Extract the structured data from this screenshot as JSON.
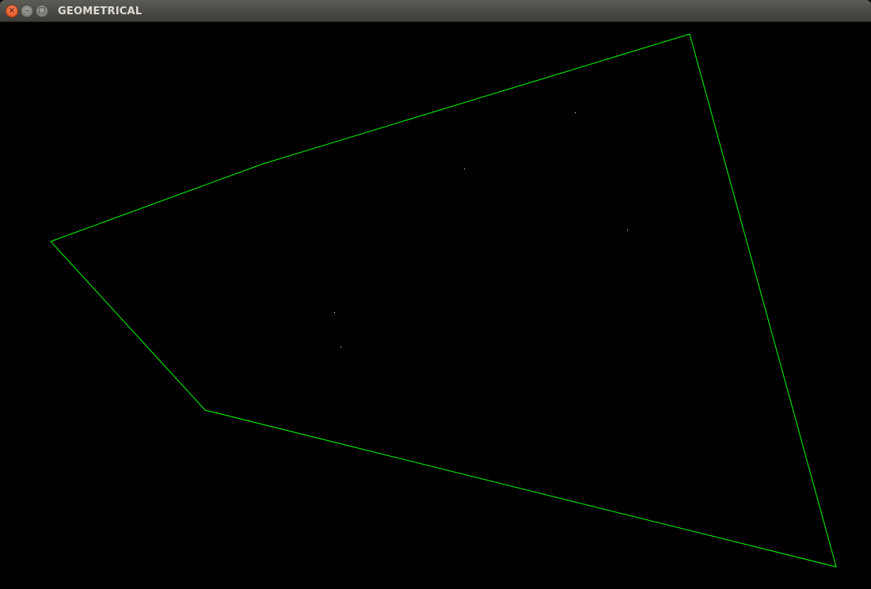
{
  "window": {
    "title": "GEOMETRICAL",
    "controls": {
      "close_icon": "×",
      "minimize_icon": "–",
      "maximize_icon": "□"
    }
  },
  "colors": {
    "background": "#000000",
    "hull_stroke": "#00ff00",
    "point_fill": "#ffffff",
    "close_button": "#e95420"
  }
}
